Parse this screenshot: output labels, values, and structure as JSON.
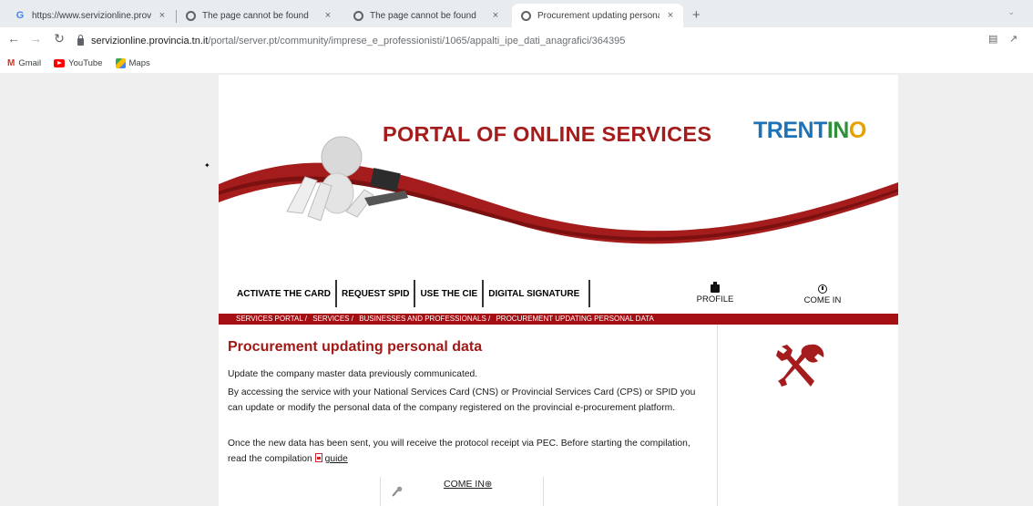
{
  "browser": {
    "tabs": [
      {
        "title": "https://www.servizionline.provin",
        "favicon": "google-g",
        "active": false
      },
      {
        "title": "The page cannot be found",
        "favicon": "globe",
        "active": false
      },
      {
        "title": "The page cannot be found",
        "favicon": "globe",
        "active": false
      },
      {
        "title": "Procurement updating personal",
        "favicon": "globe",
        "active": true
      }
    ],
    "close_glyph": "×",
    "new_tab_glyph": "+",
    "url_host": "servizionline.provincia.tn.it",
    "url_path": "/portal/server.pt/community/imprese_e_professionisti/1065/appalti_ipe_dati_anagrafici/364395",
    "bookmarks": [
      {
        "label": "Gmail",
        "icon": "gmail-icon"
      },
      {
        "label": "YouTube",
        "icon": "youtube-icon"
      },
      {
        "label": "Maps",
        "icon": "maps-icon"
      }
    ]
  },
  "header": {
    "title": "PORTAL OF ONLINE SERVICES",
    "brand_tr": "TR",
    "brand_ent": "ENT",
    "brand_in": "IN",
    "brand_o": "O"
  },
  "menu": {
    "items": [
      "ACTIVATE THE CARD",
      "REQUEST SPID",
      "USE THE CIE",
      "DIGITAL SIGNATURE"
    ],
    "profile_label": "PROFILE",
    "login_label": "COME IN"
  },
  "breadcrumb": [
    "SERVICES PORTAL /",
    "SERVICES /",
    "BUSINESSES AND PROFESSIONALS /",
    "PROCUREMENT UPDATING PERSONAL DATA"
  ],
  "main": {
    "title": "Procurement updating personal data",
    "p1": "Update the company master data previously communicated.",
    "p2": "By accessing the service with your National Services Card (CNS) or Provincial Services Card (CPS) or SPID you can update or modify the personal data of the company registered on the provincial e-procurement platform.",
    "p3": "Once the new data has been sent, you will receive the protocol receipt via PEC. Before starting the compilation, read the compilation",
    "guide_link": "guide",
    "come_in_link": "COME IN"
  },
  "colors": {
    "brand_red": "#a11a17",
    "crumb_bar": "#a40f13",
    "trentino_blue": "#1e73b8",
    "trentino_green": "#2f8f3a"
  }
}
